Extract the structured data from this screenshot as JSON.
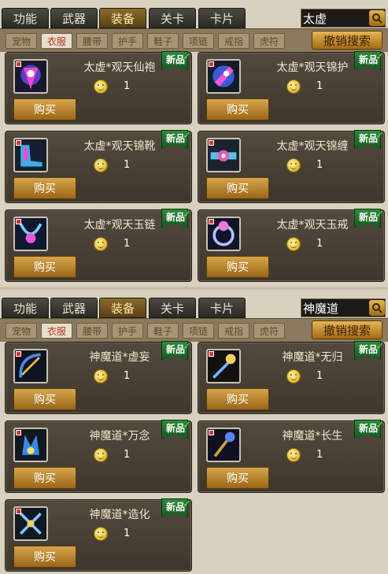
{
  "tabs": [
    "功能",
    "武器",
    "装备",
    "关卡",
    "卡片"
  ],
  "active_tab": "装备",
  "subtabs": [
    "宠物",
    "衣服",
    "腰带",
    "护手",
    "鞋子",
    "项链",
    "戒指",
    "虎符"
  ],
  "active_subtab": "衣服",
  "cancel_label": "撤销搜索",
  "buy_label": "购买",
  "new_label": "新品",
  "panel1": {
    "search_value": "太虚",
    "items": [
      {
        "name": "太虚*观天仙袍",
        "price": "1",
        "icon": "robe-icon"
      },
      {
        "name": "太虚*观天锦护",
        "price": "1",
        "icon": "gauntlet-icon"
      },
      {
        "name": "太虚*观天锦靴",
        "price": "1",
        "icon": "boots-icon"
      },
      {
        "name": "太虚*观天锦缠",
        "price": "1",
        "icon": "belt-icon"
      },
      {
        "name": "太虚*观天玉链",
        "price": "1",
        "icon": "necklace-icon"
      },
      {
        "name": "太虚*观天玉戒",
        "price": "1",
        "icon": "ring-icon"
      }
    ]
  },
  "panel2": {
    "search_value": "神魔道",
    "items": [
      {
        "name": "神魔道*虚妄",
        "price": "1",
        "icon": "bow-icon"
      },
      {
        "name": "神魔道*无归",
        "price": "1",
        "icon": "staff-icon"
      },
      {
        "name": "神魔道*万念",
        "price": "1",
        "icon": "claw-icon"
      },
      {
        "name": "神魔道*长生",
        "price": "1",
        "icon": "scepter-icon"
      },
      {
        "name": "神魔道*造化",
        "price": "1",
        "icon": "crossed-blades-icon"
      }
    ]
  }
}
